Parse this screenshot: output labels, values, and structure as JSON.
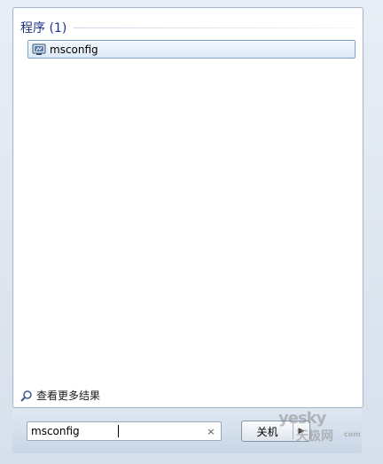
{
  "results": {
    "section_label": "程序 (1)",
    "items": [
      {
        "label": "msconfig",
        "icon": "msconfig-app-icon"
      }
    ]
  },
  "see_more": {
    "label": "查看更多结果",
    "icon": "search-icon"
  },
  "search": {
    "value": "msconfig",
    "clear_icon": "×"
  },
  "shutdown": {
    "label": "关机",
    "arrow": "▶"
  },
  "watermark": {
    "line1": "yesky",
    "line2": "天极网",
    "line3": "com"
  }
}
